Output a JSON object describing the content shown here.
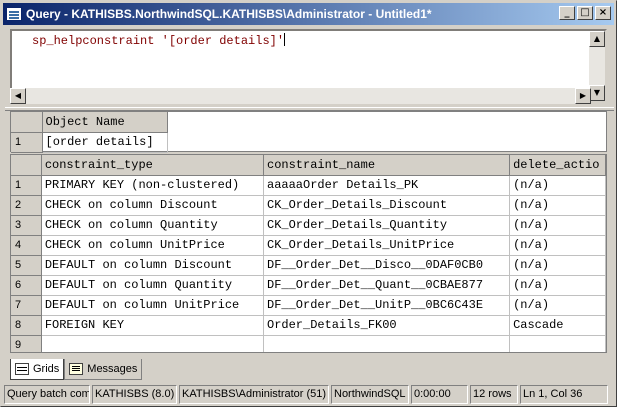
{
  "window": {
    "title": "Query - KATHISBS.NorthwindSQL.KATHISBS\\Administrator - Untitled1*",
    "min_label": "_",
    "max_label": "□",
    "close_label": "×"
  },
  "editor": {
    "text": "sp_helpconstraint '[order details]'",
    "text_color": "#800000"
  },
  "result1": {
    "columns": [
      "Object Name"
    ],
    "rows": [
      {
        "num": "1",
        "cells": [
          "[order details]"
        ]
      }
    ]
  },
  "result2": {
    "columns": [
      "constraint_type",
      "constraint_name",
      "delete_actio"
    ],
    "rows": [
      {
        "num": "1",
        "cells": [
          "PRIMARY KEY (non-clustered)",
          "aaaaaOrder Details_PK",
          "(n/a)"
        ]
      },
      {
        "num": "2",
        "cells": [
          "CHECK on column Discount",
          "CK_Order_Details_Discount",
          "(n/a)"
        ]
      },
      {
        "num": "3",
        "cells": [
          "CHECK on column Quantity",
          "CK_Order_Details_Quantity",
          "(n/a)"
        ]
      },
      {
        "num": "4",
        "cells": [
          "CHECK on column UnitPrice",
          "CK_Order_Details_UnitPrice",
          "(n/a)"
        ]
      },
      {
        "num": "5",
        "cells": [
          "DEFAULT on column Discount",
          "DF__Order_Det__Disco__0DAF0CB0",
          "(n/a)"
        ]
      },
      {
        "num": "6",
        "cells": [
          "DEFAULT on column Quantity",
          "DF__Order_Det__Quant__0CBAE877",
          "(n/a)"
        ]
      },
      {
        "num": "7",
        "cells": [
          "DEFAULT on column UnitPrice",
          "DF__Order_Det__UnitP__0BC6C43E",
          "(n/a)"
        ]
      },
      {
        "num": "8",
        "cells": [
          "FOREIGN KEY",
          "Order_Details_FK00",
          "Cascade"
        ]
      },
      {
        "num": "9",
        "cells": [
          "",
          "",
          ""
        ]
      }
    ]
  },
  "tabs": [
    {
      "label": "Grids",
      "icon": "grid-icon",
      "active": true
    },
    {
      "label": "Messages",
      "icon": "messages-icon",
      "active": false
    }
  ],
  "status": {
    "message": "Query batch com",
    "server": "KATHISBS (8.0)",
    "user": "KATHISBS\\Administrator (51)",
    "database": "NorthwindSQL",
    "elapsed": "0:00:00",
    "rows": "12 rows",
    "position": "Ln 1, Col 36"
  }
}
